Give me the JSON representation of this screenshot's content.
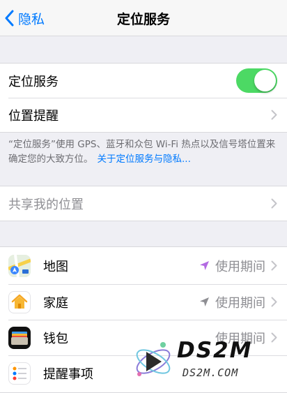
{
  "nav": {
    "back_label": "隐私",
    "title": "定位服务"
  },
  "group1": {
    "location_services_label": "定位服务",
    "location_services_on": true,
    "location_alerts_label": "位置提醒"
  },
  "note": {
    "text": "“定位服务”使用 GPS、蓝牙和众包 Wi-Fi 热点以及信号塔位置来确定您的大致方位。",
    "link": "关于定位服务与隐私..."
  },
  "share": {
    "label": "共享我的位置"
  },
  "apps": [
    {
      "name": "地图",
      "status": "使用期间",
      "arrow_color": "#b36ae2",
      "icon": "maps-icon"
    },
    {
      "name": "家庭",
      "status": "使用期间",
      "arrow_color": "#8e8e93",
      "icon": "home-icon"
    },
    {
      "name": "钱包",
      "status": "使用期间",
      "arrow_color": "#8e8e93",
      "icon": "wallet-icon"
    },
    {
      "name": "提醒事项",
      "status": "",
      "arrow_color": "#8e8e93",
      "icon": "reminders-icon"
    }
  ],
  "watermark": {
    "logo": "DS2M",
    "site": "DS2M.COM"
  },
  "colors": {
    "accent": "#007aff",
    "toggle_on": "#4cd964"
  }
}
